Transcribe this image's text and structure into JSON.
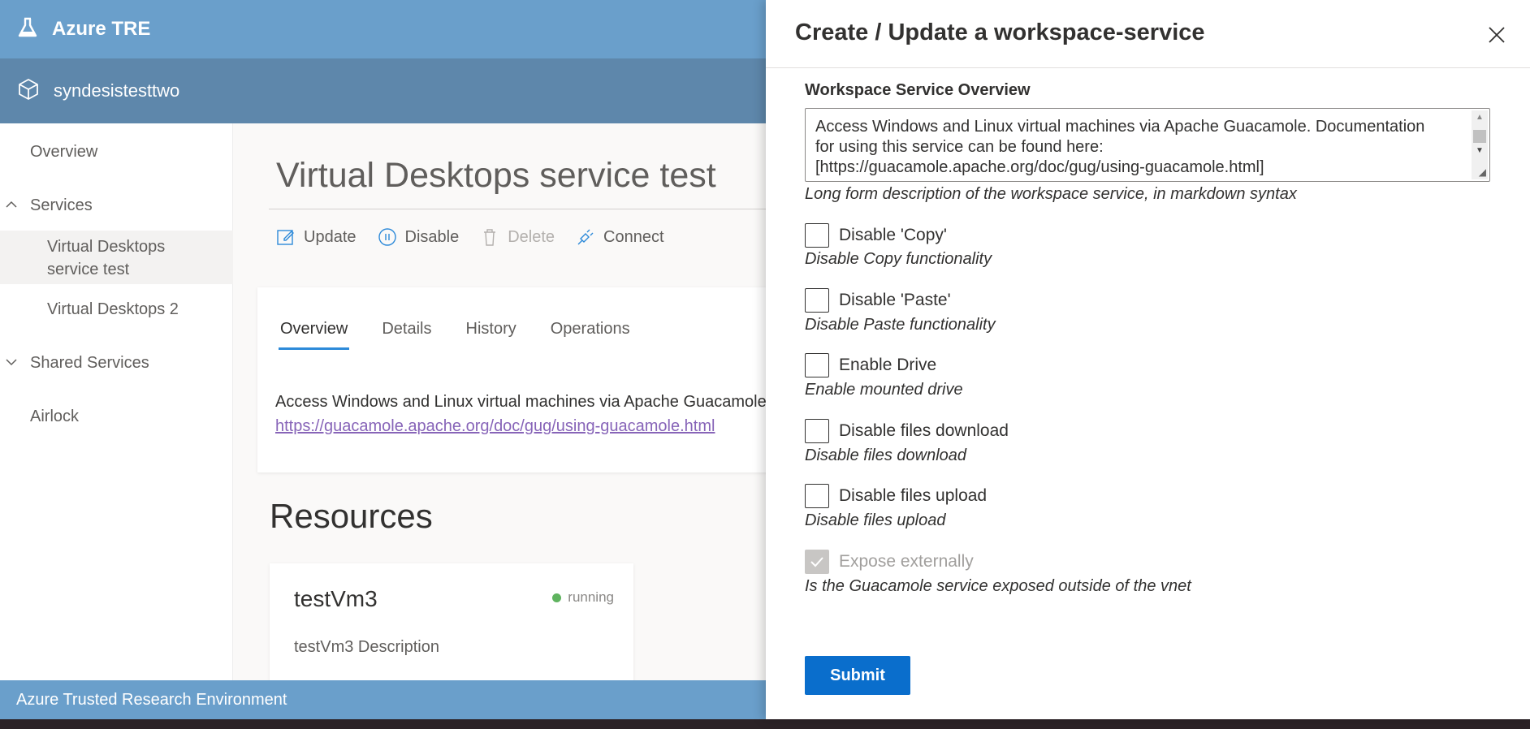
{
  "app": {
    "title": "Azure TRE",
    "workspace_name": "syndesistesttwo",
    "footer_text": "Azure Trusted Research Environment"
  },
  "sidebar": {
    "items": [
      {
        "label": "Overview"
      },
      {
        "label": "Services"
      },
      {
        "label": "Virtual Desktops service test"
      },
      {
        "label": "Virtual Desktops 2"
      },
      {
        "label": "Shared Services"
      },
      {
        "label": "Airlock"
      }
    ]
  },
  "main": {
    "page_title": "Virtual Desktops service test",
    "commands": {
      "update": "Update",
      "disable": "Disable",
      "delete": "Delete",
      "connect": "Connect"
    },
    "tabs": [
      "Overview",
      "Details",
      "History",
      "Operations"
    ],
    "description": "Access Windows and Linux virtual machines via Apache Guacamole. Documentation",
    "link": "https://guacamole.apache.org/doc/gug/using-guacamole.html",
    "resources_title": "Resources",
    "resource": {
      "name": "testVm3",
      "status": "running",
      "description": "testVm3 Description"
    }
  },
  "panel": {
    "title": "Create / Update a workspace-service",
    "overview_label": "Workspace Service Overview",
    "overview_value_line1": "Access Windows and Linux virtual machines via Apache Guacamole. Documentation",
    "overview_value_line2": "for using this service can be found here:",
    "overview_value_line3": "[https://guacamole.apache.org/doc/gug/using-guacamole.html]",
    "overview_help": "Long form description of the workspace service, in markdown syntax",
    "options": [
      {
        "label": "Disable 'Copy'",
        "help": "Disable Copy functionality",
        "checked": false,
        "disabled": false
      },
      {
        "label": "Disable 'Paste'",
        "help": "Disable Paste functionality",
        "checked": false,
        "disabled": false
      },
      {
        "label": "Enable Drive",
        "help": "Enable mounted drive",
        "checked": false,
        "disabled": false
      },
      {
        "label": "Disable files download",
        "help": "Disable files download",
        "checked": false,
        "disabled": false
      },
      {
        "label": "Disable files upload",
        "help": "Disable files upload",
        "checked": false,
        "disabled": false
      },
      {
        "label": "Expose externally",
        "help": "Is the Guacamole service exposed outside of the vnet",
        "checked": true,
        "disabled": true
      }
    ],
    "submit_label": "Submit"
  },
  "colors": {
    "header": "#6a9fcb",
    "workspace_bar": "#5e87ab",
    "primary_button": "#0a6ecc",
    "status_running": "#5fb35f"
  }
}
